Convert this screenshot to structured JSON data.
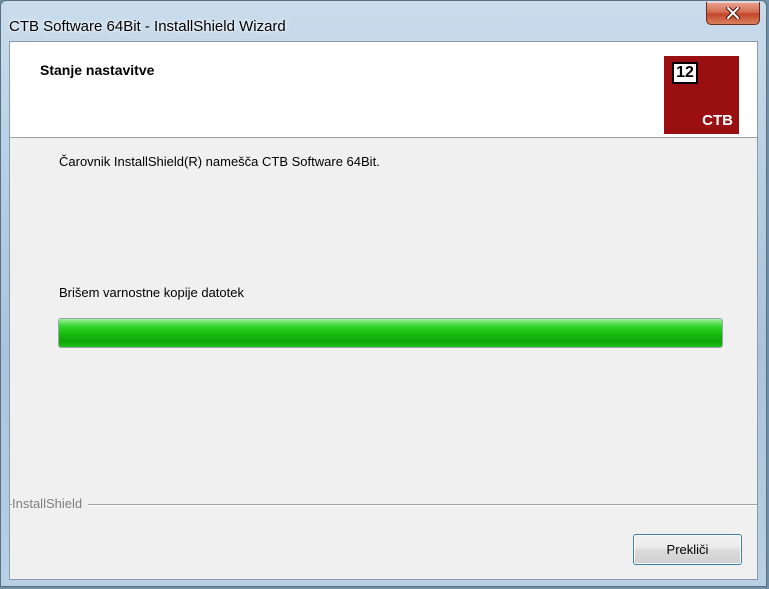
{
  "window": {
    "title": "CTB Software 64Bit - InstallShield Wizard",
    "close_icon": "close-icon"
  },
  "header": {
    "title": "Stanje nastavitve",
    "logo": {
      "badge": "12",
      "text": "CTB",
      "color": "#9a0f12"
    }
  },
  "body": {
    "description": "Čarovnik InstallShield(R) namešča CTB Software 64Bit.",
    "status_text": "Brišem varnostne kopije datotek",
    "progress": {
      "fraction": 1.0,
      "color": "#16c00e"
    }
  },
  "footer": {
    "brand": "InstallShield",
    "cancel_label": "Prekliči"
  }
}
